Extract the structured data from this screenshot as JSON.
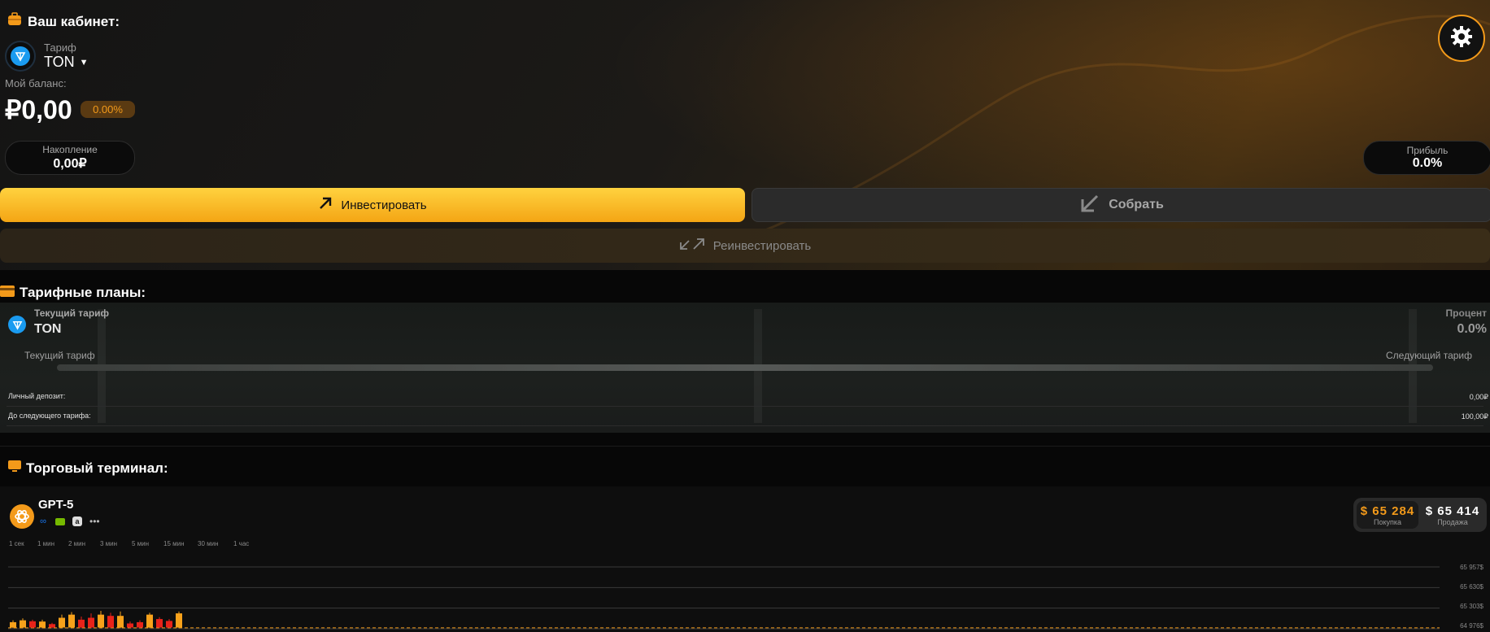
{
  "cabinet": {
    "title": "Ваш кабинет:",
    "tariff_label": "Тариф",
    "tariff_value": "TON",
    "balance_label": "Мой баланс:",
    "balance_value": "₽0,00",
    "balance_percent": "0.00%",
    "accumulation_label": "Накопление",
    "accumulation_value": "0,00₽",
    "profit_label": "Прибыль",
    "profit_value": "0.0%",
    "invest_label": "Инвестировать",
    "collect_label": "Собрать",
    "reinvest_label": "Реинвестировать"
  },
  "plans": {
    "title": "Тарифные планы:",
    "current_tariff_label": "Текущий тариф",
    "current_tariff_value": "TON",
    "percent_label": "Процент",
    "percent_value": "0.0%",
    "progress_left_label": "Текущий тариф",
    "progress_right_label": "Следующий тариф",
    "progress_fraction": 0,
    "personal_deposit_label": "Личный депозит:",
    "personal_deposit_value": "0,00₽",
    "to_next_label": "До следующего тарифа:",
    "to_next_value": "100,00₽"
  },
  "terminal": {
    "title": "Торговый терминал:",
    "asset_name": "GPT-5",
    "more_label": "•••",
    "buy_price": "$ 65 284",
    "buy_label": "Покупка",
    "sell_price": "$ 65 414",
    "sell_label": "Продажа",
    "timeframes": [
      "1 сек",
      "1 мин",
      "2 мин",
      "3 мин",
      "5 мин",
      "15 мин",
      "30 мин",
      "1 час"
    ],
    "y_labels": [
      "65 957$",
      "65 630$",
      "65 303$",
      "64 976$"
    ]
  },
  "colors": {
    "accent": "#f39a1a",
    "invest_top": "#ffd23f",
    "invest_bottom": "#f4a514",
    "candle_up": "#f7a21b",
    "candle_down": "#e8231a"
  },
  "chart_data": {
    "type": "candlestick",
    "y_ticks": [
      65957,
      65630,
      65303,
      64976
    ],
    "ylim": [
      64976,
      65957
    ],
    "price_line": 64990,
    "candles": [
      {
        "dir": "up",
        "open": 64995,
        "close": 65080,
        "high": 65110,
        "low": 64985
      },
      {
        "dir": "up",
        "open": 64995,
        "close": 65110,
        "high": 65140,
        "low": 64985
      },
      {
        "dir": "down",
        "open": 65095,
        "close": 64995,
        "high": 65120,
        "low": 64985
      },
      {
        "dir": "up",
        "open": 64995,
        "close": 65090,
        "high": 65120,
        "low": 64985
      },
      {
        "dir": "down",
        "open": 65050,
        "close": 64995,
        "high": 65070,
        "low": 64985
      },
      {
        "dir": "up",
        "open": 64995,
        "close": 65150,
        "high": 65200,
        "low": 64985
      },
      {
        "dir": "up",
        "open": 64995,
        "close": 65200,
        "high": 65240,
        "low": 64985
      },
      {
        "dir": "down",
        "open": 65120,
        "close": 64995,
        "high": 65170,
        "low": 64985
      },
      {
        "dir": "down",
        "open": 65150,
        "close": 64995,
        "high": 65220,
        "low": 64985
      },
      {
        "dir": "up",
        "open": 64995,
        "close": 65200,
        "high": 65260,
        "low": 64985
      },
      {
        "dir": "down",
        "open": 65180,
        "close": 64995,
        "high": 65230,
        "low": 64985
      },
      {
        "dir": "up",
        "open": 64995,
        "close": 65180,
        "high": 65250,
        "low": 64985
      },
      {
        "dir": "down",
        "open": 65060,
        "close": 64995,
        "high": 65090,
        "low": 64985
      },
      {
        "dir": "down",
        "open": 65080,
        "close": 64995,
        "high": 65110,
        "low": 64985
      },
      {
        "dir": "up",
        "open": 64995,
        "close": 65200,
        "high": 65230,
        "low": 64985
      },
      {
        "dir": "down",
        "open": 65130,
        "close": 64995,
        "high": 65160,
        "low": 64985
      },
      {
        "dir": "down",
        "open": 65100,
        "close": 64995,
        "high": 65130,
        "low": 64985
      },
      {
        "dir": "up",
        "open": 64995,
        "close": 65220,
        "high": 65250,
        "low": 64985
      }
    ]
  }
}
